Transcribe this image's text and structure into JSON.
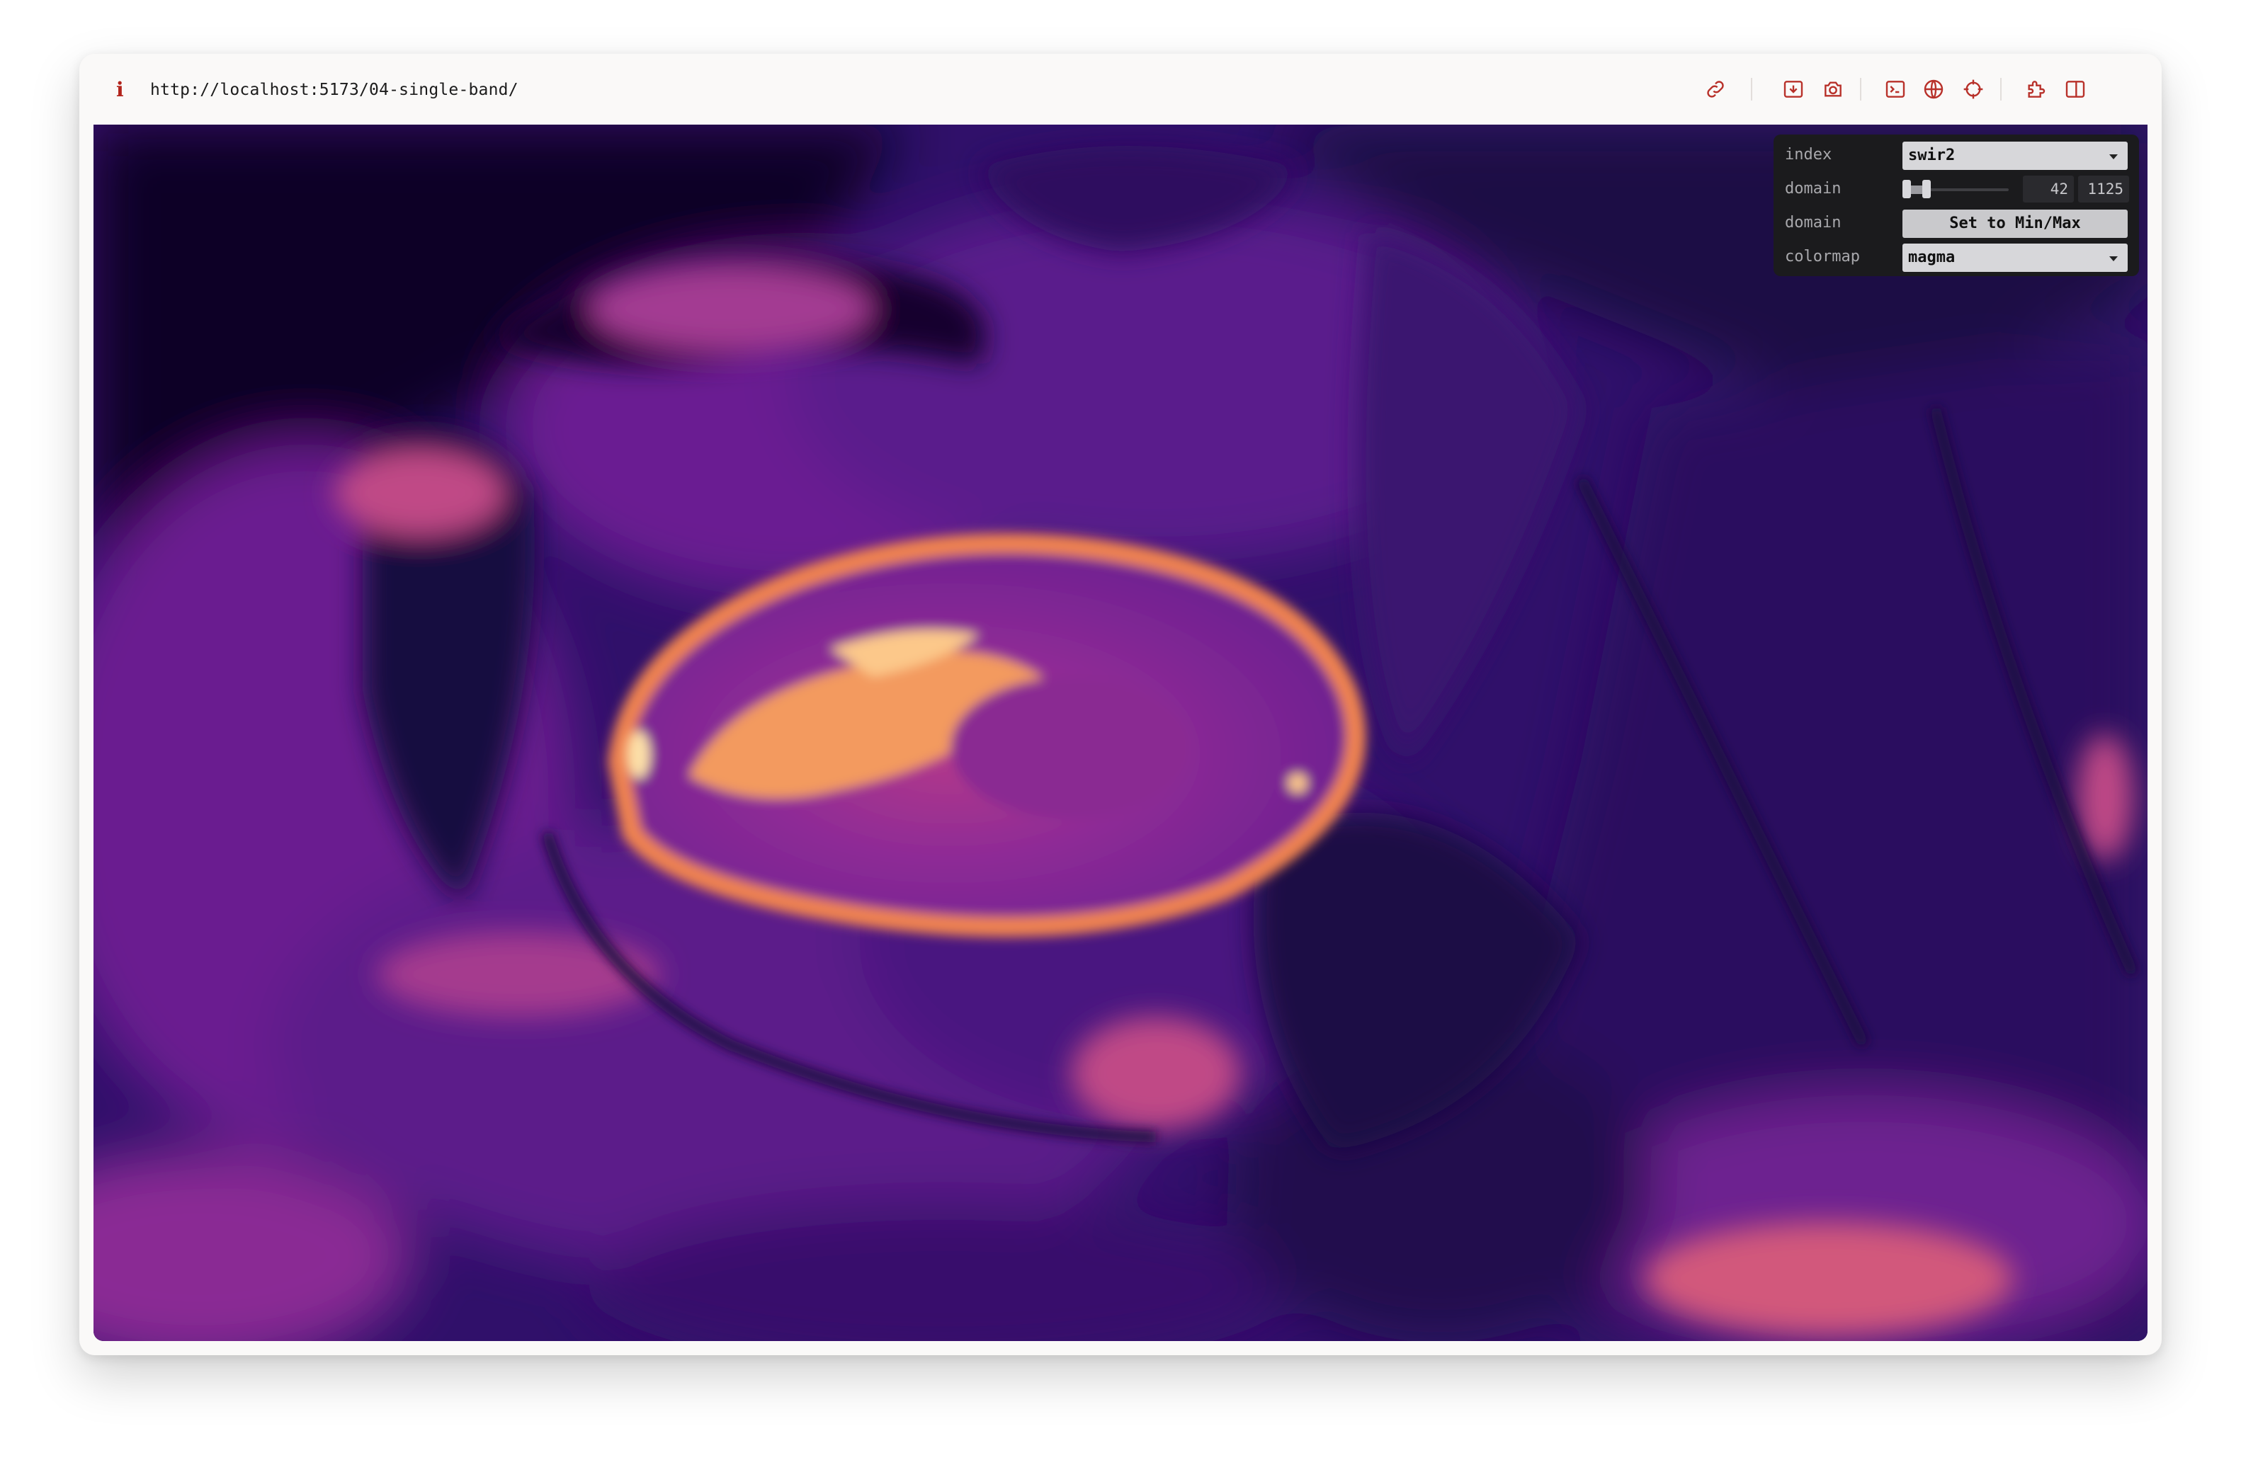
{
  "browser": {
    "info_icon": "i",
    "url": "http://localhost:5173/04-single-band/",
    "toolbar_icons": [
      "link-icon",
      "download-icon",
      "camera-icon",
      "terminal-icon",
      "globe-icon",
      "crosshair-icon",
      "extension-icon",
      "sidebar-icon"
    ]
  },
  "controls": {
    "index": {
      "label": "index",
      "value": "swir2"
    },
    "domain_slider": {
      "label": "domain",
      "min": 42,
      "max": 1125,
      "min_text": "42",
      "max_text": "1125"
    },
    "domain_button": {
      "label": "domain",
      "text": "Set to Min/Max"
    },
    "colormap": {
      "label": "colormap",
      "value": "magma"
    }
  },
  "map": {
    "content": "single-band raster rendered with magma colormap",
    "colors": {
      "dark": "#0f0628",
      "deep": "#2b0b5c",
      "purple": "#5a1a8c",
      "magenta": "#9a2d96",
      "pink": "#d6507a",
      "orange": "#f2885a",
      "light": "#fcc88a"
    }
  }
}
